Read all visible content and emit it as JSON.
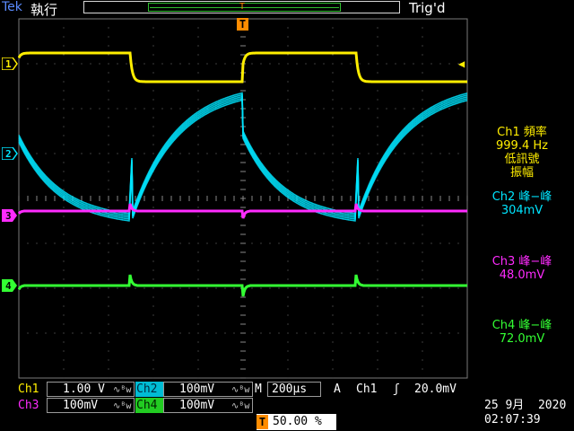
{
  "header": {
    "brand": "Tek",
    "mode": "執行",
    "trigger_status": "Trig'd",
    "position_marker": "T"
  },
  "channels": [
    {
      "id": "1",
      "color": "#ffee00"
    },
    {
      "id": "2",
      "color": "#00e5ff"
    },
    {
      "id": "3",
      "color": "#ff2bff"
    },
    {
      "id": "4",
      "color": "#33ff33"
    }
  ],
  "trigger": {
    "marker": "T",
    "level_marker": "◀"
  },
  "measurements": {
    "ch1_title": "Ch1 頻率",
    "ch1_value": "999.4 Hz",
    "ch1_note_1": "低訊號",
    "ch1_note_2": "振幅",
    "ch2_title": "Ch2 峰−峰",
    "ch2_value": "304mV",
    "ch3_title": "Ch3 峰−峰",
    "ch3_value": "48.0mV",
    "ch4_title": "Ch4 峰−峰",
    "ch4_value": "72.0mV"
  },
  "bottom": {
    "ch1_label": "Ch1",
    "ch1_scale": "1.00 V",
    "ch2_label": "Ch2",
    "ch2_scale": "100mV",
    "ch3_label": "Ch3",
    "ch3_scale": "100mV",
    "ch4_label": "Ch4",
    "ch4_scale": "100mV",
    "bw_icon_text": "∿ᴮw",
    "timebase_label": "M",
    "timebase_value": "200µs",
    "trig_mode": "A",
    "trig_source": "Ch1",
    "trig_slope": "ʃ",
    "trig_level": "20.0mV",
    "position_marker": "T",
    "position_pct": "50.00 %",
    "date": "25 9月  2020",
    "time": "02:07:39"
  }
}
